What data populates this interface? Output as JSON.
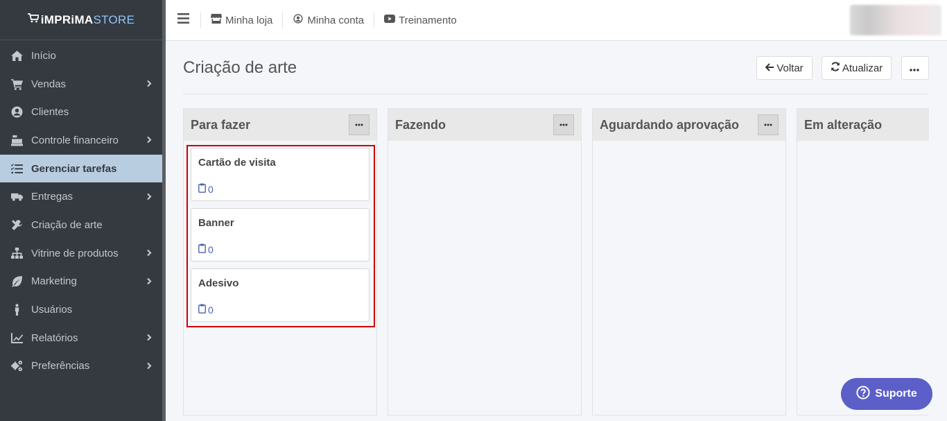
{
  "brand": {
    "prefix": "iMPRiMA",
    "suffix": "STORE"
  },
  "sidebar": {
    "items": [
      {
        "label": "Início",
        "icon": "home-icon",
        "chevron": false,
        "active": false
      },
      {
        "label": "Vendas",
        "icon": "cart-icon",
        "chevron": true,
        "active": false
      },
      {
        "label": "Clientes",
        "icon": "user-circle-icon",
        "chevron": false,
        "active": false
      },
      {
        "label": "Controle financeiro",
        "icon": "cash-register-icon",
        "chevron": true,
        "active": false
      },
      {
        "label": "Gerenciar tarefas",
        "icon": "tasks-icon",
        "chevron": false,
        "active": true
      },
      {
        "label": "Entregas",
        "icon": "truck-icon",
        "chevron": true,
        "active": false
      },
      {
        "label": "Criação de arte",
        "icon": "tools-icon",
        "chevron": false,
        "active": false
      },
      {
        "label": "Vitrine de produtos",
        "icon": "sitemap-icon",
        "chevron": true,
        "active": false
      },
      {
        "label": "Marketing",
        "icon": "leaf-icon",
        "chevron": true,
        "active": false
      },
      {
        "label": "Usuários",
        "icon": "person-icon",
        "chevron": false,
        "active": false
      },
      {
        "label": "Relatórios",
        "icon": "chart-line-icon",
        "chevron": true,
        "active": false
      },
      {
        "label": "Preferências",
        "icon": "cogs-icon",
        "chevron": true,
        "active": false
      }
    ]
  },
  "topbar": {
    "links": [
      {
        "label": "Minha loja",
        "icon": "store-icon"
      },
      {
        "label": "Minha conta",
        "icon": "user-circle-icon"
      },
      {
        "label": "Treinamento",
        "icon": "youtube-icon"
      }
    ]
  },
  "page": {
    "title": "Criação de arte",
    "buttons": {
      "back": "Voltar",
      "refresh": "Atualizar"
    }
  },
  "board": {
    "columns": [
      {
        "title": "Para fazer",
        "has_menu": true,
        "cards": [
          {
            "title": "Cartão de visita",
            "count": "0"
          },
          {
            "title": "Banner",
            "count": "0"
          },
          {
            "title": "Adesivo",
            "count": "0"
          }
        ]
      },
      {
        "title": "Fazendo",
        "has_menu": true,
        "cards": []
      },
      {
        "title": "Aguardando aprovação",
        "has_menu": true,
        "cards": []
      },
      {
        "title": "Em alteração",
        "has_menu": false,
        "cards": []
      }
    ]
  },
  "support": {
    "label": "Suporte"
  },
  "colors": {
    "sidebar_bg": "#343a40",
    "sidebar_active": "#b9cde0",
    "accent": "#5b5fc7",
    "highlight": "#cc0000",
    "link": "#4c5fb5"
  }
}
